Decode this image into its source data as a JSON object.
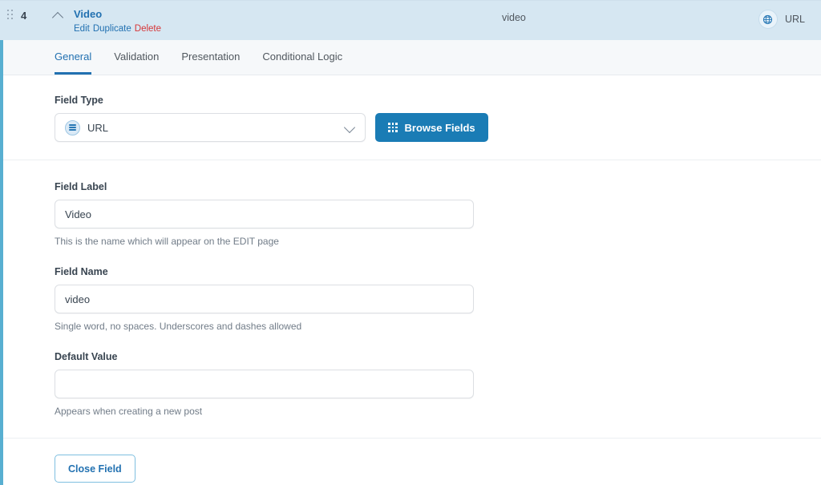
{
  "field": {
    "order_number": "4",
    "title": "Video",
    "name": "video",
    "type_label": "URL",
    "actions": {
      "edit": "Edit",
      "duplicate": "Duplicate",
      "delete": "Delete"
    },
    "icons": {
      "drag_handle": "drag-handle-icon",
      "collapse": "chevron-up-icon",
      "type_badge": "globe-icon"
    }
  },
  "tabs": [
    {
      "label": "General",
      "active": true
    },
    {
      "label": "Validation",
      "active": false
    },
    {
      "label": "Presentation",
      "active": false
    },
    {
      "label": "Conditional Logic",
      "active": false
    }
  ],
  "general": {
    "field_type": {
      "label": "Field Type",
      "selected": "URL",
      "icon": "url-circle-icon",
      "browse_button": "Browse Fields",
      "browse_icon": "grid-dots-icon"
    },
    "field_label": {
      "label": "Field Label",
      "value": "Video",
      "placeholder": "",
      "help": "This is the name which will appear on the EDIT page"
    },
    "field_name": {
      "label": "Field Name",
      "value": "video",
      "placeholder": "",
      "help": "Single word, no spaces. Underscores and dashes allowed"
    },
    "default_value": {
      "label": "Default Value",
      "value": "",
      "placeholder": "",
      "help": "Appears when creating a new post"
    }
  },
  "footer": {
    "close_button": "Close Field"
  },
  "colors": {
    "accent": "#2271b1",
    "header_bg": "#d6e7f2",
    "side_bar": "#58afd1",
    "primary_button": "#1a7cb5",
    "delete_link": "#d63638"
  }
}
